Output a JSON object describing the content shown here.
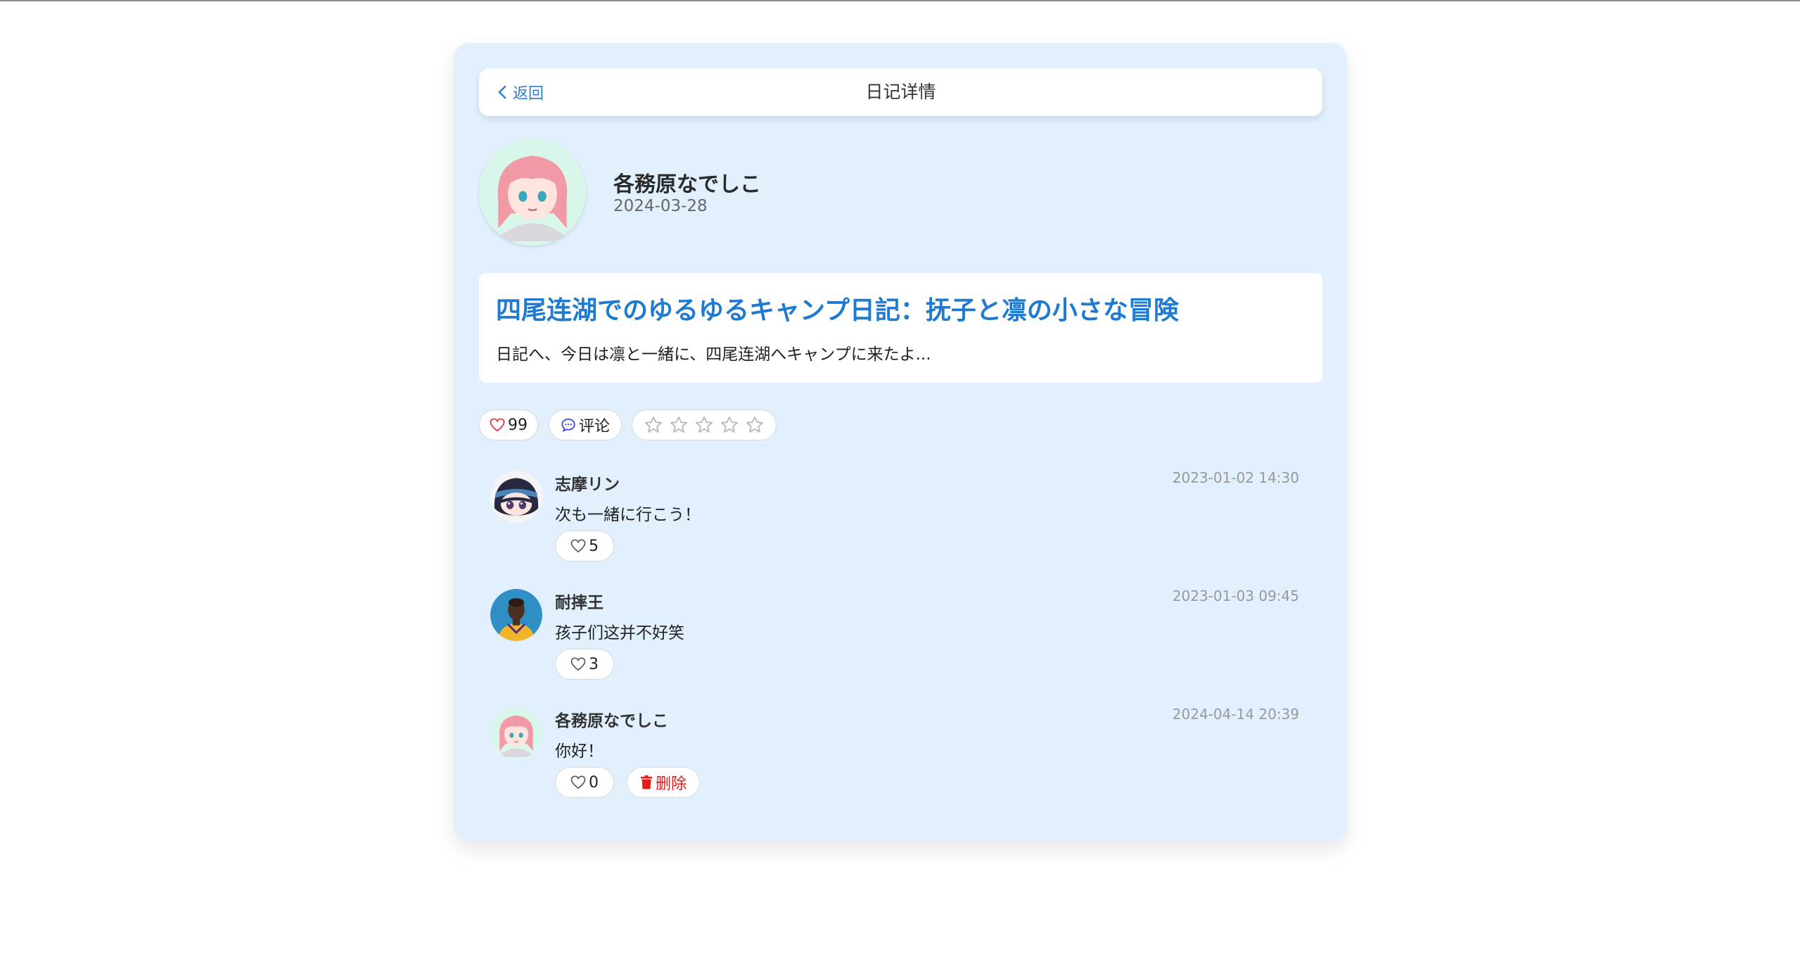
{
  "topbar": {
    "back_label": "返回",
    "title": "日记详情"
  },
  "author": {
    "name": "各務原なでしこ",
    "date": "2024-03-28"
  },
  "diary": {
    "title": "四尾连湖でのゆるゆるキャンプ日記：抚子と凛の小さな冒険",
    "excerpt": "日記へ、今日は凛と一緒に、四尾连湖へキャンプに来たよ..."
  },
  "actions": {
    "likes": "99",
    "comment_label": "评论",
    "rating": 0,
    "rating_max": 5
  },
  "comments": [
    {
      "user": "志摩リン",
      "time": "2023-01-02 14:30",
      "text": "次も一緒に行こう！",
      "likes": "5",
      "avatar": "shima-rin-avatar"
    },
    {
      "user": "耐摔王",
      "time": "2023-01-03 09:45",
      "text": "孩子们这并不好笑",
      "likes": "3",
      "avatar": "basketball-player-avatar"
    },
    {
      "user": "各務原なでしこ",
      "time": "2024-04-14 20:39",
      "text": "你好！",
      "likes": "0",
      "avatar": "nadeshiko-avatar",
      "delete_label": "删除"
    }
  ],
  "colors": {
    "card_bg": "#e1f0fc",
    "accent_blue": "#1f7ad1",
    "like_red": "#e0364a",
    "delete_red": "#e31b1b",
    "comment_icon_blue": "#3a4fd0"
  }
}
